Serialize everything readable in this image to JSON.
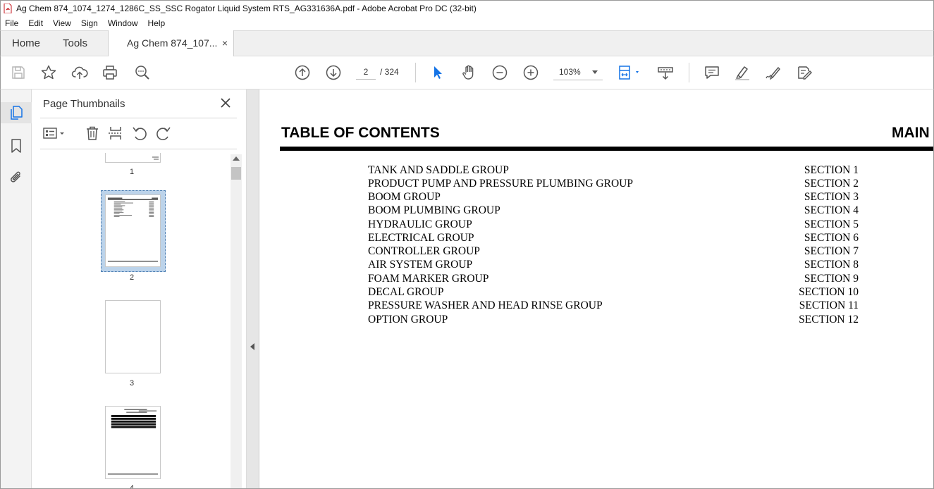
{
  "window": {
    "title": "Ag Chem 874_1074_1274_1286C_SS_SSC Rogator Liquid System RTS_AG331636A.pdf - Adobe Acrobat Pro DC (32-bit)",
    "icon": "acrobat-icon"
  },
  "menu": {
    "items": [
      "File",
      "Edit",
      "View",
      "Sign",
      "Window",
      "Help"
    ]
  },
  "tabs": {
    "home": "Home",
    "tools": "Tools",
    "document": "Ag Chem 874_107...",
    "close_glyph": "×"
  },
  "toolbar": {
    "icons": [
      "save-icon",
      "star-icon",
      "cloud-upload-icon",
      "print-icon",
      "find-zoom-icon",
      "page-up-icon",
      "page-down-icon",
      "select-cursor-icon",
      "hand-icon",
      "zoom-out-icon",
      "zoom-in-icon",
      "fit-page-icon",
      "scroll-mode-icon",
      "comment-icon",
      "highlight-icon",
      "draw-icon",
      "fill-sign-icon"
    ],
    "current_page": "2",
    "page_total": "/  324",
    "zoom": "103%"
  },
  "rail": {
    "icons": [
      "page-thumbnails-icon",
      "bookmark-icon",
      "attachment-icon"
    ]
  },
  "thumbnails_panel": {
    "title": "Page Thumbnails",
    "icons": [
      "options-menu-icon",
      "delete-page-icon",
      "extract-page-icon",
      "rotate-counterclockwise-icon",
      "rotate-clockwise-icon"
    ],
    "pages": [
      {
        "number": "1",
        "selected": false
      },
      {
        "number": "2",
        "selected": true
      },
      {
        "number": "3",
        "selected": false
      },
      {
        "number": "4",
        "selected": false
      }
    ]
  },
  "document": {
    "heading": "TABLE OF CONTENTS",
    "heading_right": "MAIN",
    "toc": [
      {
        "name": "TANK AND SADDLE GROUP",
        "section": "SECTION 1"
      },
      {
        "name": "PRODUCT PUMP AND PRESSURE PLUMBING GROUP",
        "section": "SECTION 2"
      },
      {
        "name": "BOOM GROUP",
        "section": "SECTION 3"
      },
      {
        "name": "BOOM PLUMBING GROUP",
        "section": "SECTION 4"
      },
      {
        "name": "HYDRAULIC GROUP",
        "section": "SECTION 5"
      },
      {
        "name": "ELECTRICAL GROUP",
        "section": "SECTION 6"
      },
      {
        "name": "CONTROLLER GROUP",
        "section": "SECTION 7"
      },
      {
        "name": "AIR SYSTEM GROUP",
        "section": "SECTION 8"
      },
      {
        "name": "FOAM MARKER GROUP",
        "section": "SECTION 9"
      },
      {
        "name": "DECAL GROUP",
        "section": "SECTION 10"
      },
      {
        "name": "PRESSURE WASHER AND HEAD RINSE GROUP",
        "section": "SECTION 11"
      },
      {
        "name": "OPTION GROUP",
        "section": "SECTION 12"
      }
    ]
  }
}
